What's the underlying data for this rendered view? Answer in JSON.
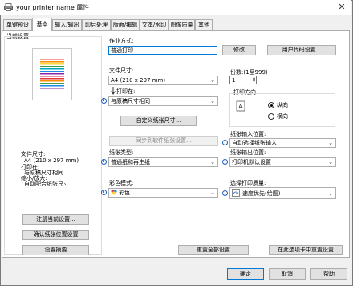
{
  "window": {
    "title": "your printer name 属性",
    "close": "✕"
  },
  "tabs": [
    {
      "label": "单键预设"
    },
    {
      "label": "基本"
    },
    {
      "label": "输入/输出"
    },
    {
      "label": "印后处理"
    },
    {
      "label": "版面/编辑"
    },
    {
      "label": "文本/水印"
    },
    {
      "label": "图像质量"
    },
    {
      "label": "其他"
    }
  ],
  "left": {
    "section_title": "当前设置",
    "summary": {
      "doc_size_label": "文件尺寸:",
      "doc_size_value": "A4 (210 x 297 mm)",
      "print_on_label": "打印在:",
      "print_on_value": "与原稿尺寸相同",
      "zoom_label": "缩小/放大:",
      "zoom_value": "自动配合纸张尺寸"
    },
    "buttons": {
      "register": "注册当前设置...",
      "confirm_paper": "确认纸张位置设置",
      "settings_summary": "设置摘要"
    }
  },
  "job": {
    "label": "作业方式:",
    "value": "普通打印",
    "modify": "修改",
    "user_code": "用户代码设置..."
  },
  "doc_size": {
    "label": "文件尺寸:",
    "value": "A4 (210 x 297 mm)"
  },
  "print_on": {
    "label": "打印在:",
    "value": "与原稿尺寸相同"
  },
  "custom_paper": "自定义纸张尺寸...",
  "sync_settings": "同步到软件纸张设置...",
  "paper_type": {
    "label": "纸张类型:",
    "value": "普通纸和再生纸"
  },
  "color_mode": {
    "label": "彩色模式:",
    "value": "彩色"
  },
  "copies": {
    "label": "份数:(1至999)",
    "value": "1"
  },
  "orientation": {
    "label": "打印方向",
    "options": [
      "纵向",
      "横向"
    ],
    "selected": "纵向"
  },
  "input_tray": {
    "label": "纸张输入位置:",
    "value": "自动选择纸张输入"
  },
  "output_tray": {
    "label": "纸张输出位置:",
    "value": "打印机默认设置"
  },
  "quality": {
    "label": "选择打印质量:",
    "value": "速度优先(绘图)"
  },
  "reset_all": "重置全部设置",
  "reset_tab": "在此选项卡中重置设置",
  "footer": {
    "ok": "确定",
    "cancel": "取消",
    "help": "帮助"
  },
  "colors": {
    "accent": "#0078d7",
    "info": "#1f5fbf"
  }
}
